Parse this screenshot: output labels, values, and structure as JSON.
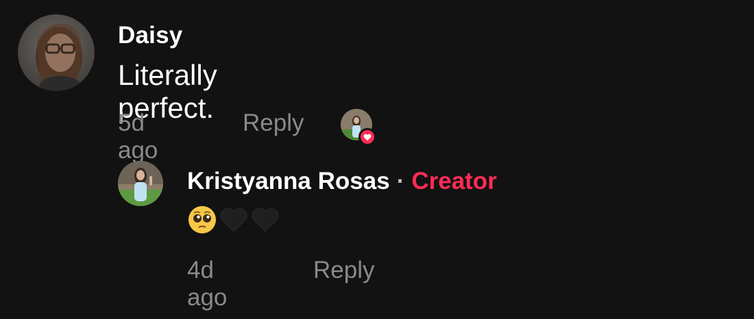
{
  "comments": [
    {
      "username": "Daisy",
      "text": "Literally perfect.",
      "time": "5d ago",
      "reply_label": "Reply",
      "avatar_icon": "profile-photo-glasses",
      "creator_liked": true
    }
  ],
  "replies": [
    {
      "username": "Kristyanna Rosas",
      "separator": "·",
      "badge": "Creator",
      "emojis": [
        "pleading-face-emoji",
        "black-heart-emoji",
        "black-heart-emoji"
      ],
      "time": "4d ago",
      "reply_label": "Reply",
      "avatar_icon": "profile-photo-outdoor"
    }
  ],
  "colors": {
    "background": "#121212",
    "primary_text": "#ffffff",
    "secondary_text": "#8a8a8a",
    "accent": "#fe2c55"
  }
}
